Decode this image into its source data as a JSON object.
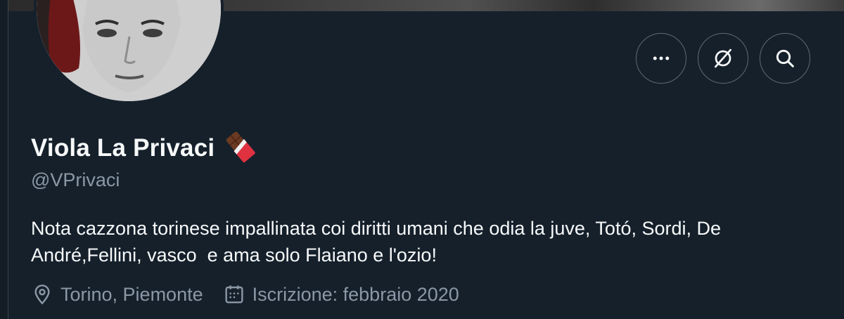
{
  "profile": {
    "display_name": "Viola La Privaci",
    "name_emoji": "chocolate-bar-icon",
    "handle": "@VPrivaci",
    "bio_line1": "Nota cazzona torinese impallinata coi diritti umani che odia la juve, Totó, Sordi, De",
    "bio_line2": "André,Fellini, vasco  e ama solo Flaiano e l'ozio!",
    "location": "Torino, Piemonte",
    "joined": "Iscrizione: febbraio 2020"
  },
  "actions": [
    {
      "icon": "more-icon"
    },
    {
      "icon": "grok-icon"
    },
    {
      "icon": "search-icon"
    }
  ],
  "colors": {
    "background": "#15202b",
    "text_primary": "#f7f9f9",
    "text_secondary": "#8b98a5",
    "button_border": "#5b6b78"
  }
}
